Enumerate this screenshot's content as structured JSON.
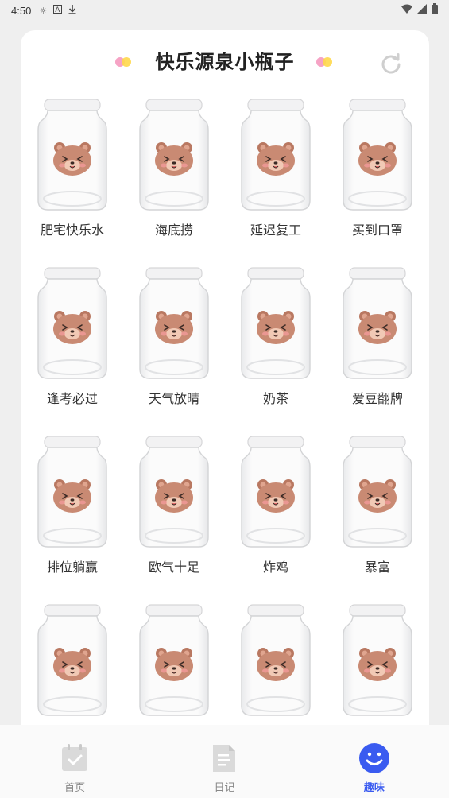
{
  "status_bar": {
    "time": "4:50",
    "left_icons": [
      "notification-icon",
      "a-icon",
      "download-icon"
    ],
    "right_icons": [
      "wifi-icon",
      "signal-icon",
      "battery-icon"
    ]
  },
  "header": {
    "title": "快乐源泉小瓶子",
    "refresh_icon": "refresh-icon"
  },
  "jars": [
    {
      "label": "肥宅快乐水"
    },
    {
      "label": "海底捞"
    },
    {
      "label": "延迟复工"
    },
    {
      "label": "买到口罩"
    },
    {
      "label": "逢考必过"
    },
    {
      "label": "天气放晴"
    },
    {
      "label": "奶茶"
    },
    {
      "label": "爱豆翻牌"
    },
    {
      "label": "排位躺赢"
    },
    {
      "label": "欧气十足"
    },
    {
      "label": "炸鸡"
    },
    {
      "label": "暴富"
    },
    {
      "label": ""
    },
    {
      "label": ""
    },
    {
      "label": ""
    },
    {
      "label": ""
    }
  ],
  "bottom_nav": {
    "items": [
      {
        "label": "首页",
        "icon": "calendar-check-icon",
        "active": false
      },
      {
        "label": "日记",
        "icon": "document-icon",
        "active": false
      },
      {
        "label": "趣味",
        "icon": "smile-icon",
        "active": true
      }
    ]
  },
  "colors": {
    "accent": "#3a5bf0",
    "bear": "#c98a73"
  }
}
